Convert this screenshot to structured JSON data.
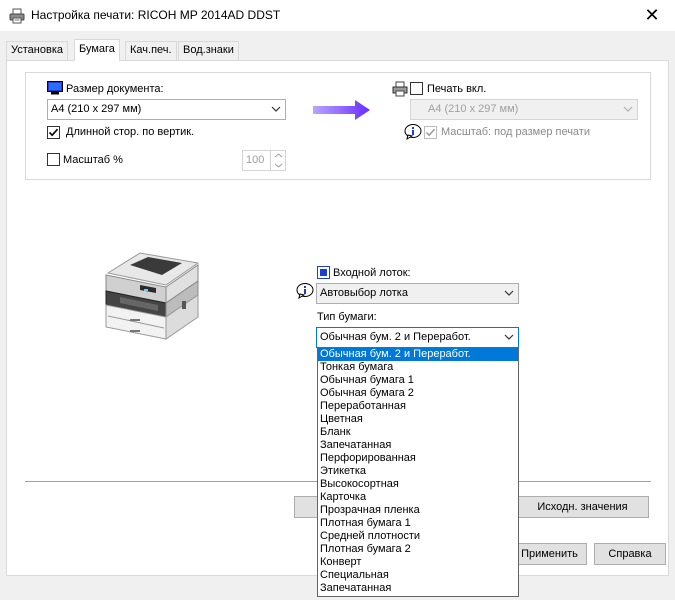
{
  "window": {
    "title": "Настройка печати: RICOH MP 2014AD DDST",
    "close_glyph": "✕"
  },
  "tabs": [
    {
      "label": "Установка"
    },
    {
      "label": "Бумага"
    },
    {
      "label": "Кач.печ."
    },
    {
      "label": "Вод.знаки"
    }
  ],
  "document": {
    "size_label": "Размер документа:",
    "size_value": "A4 (210 x 297 мм)",
    "long_edge_label": "Длинной стор. по вертик.",
    "long_edge_checked": true,
    "scale_label": "Масштаб %",
    "scale_checked": false,
    "scale_value": "100"
  },
  "print_on": {
    "label": "Печать вкл.",
    "checked": false,
    "size_value": "A4 (210 x 297 мм)",
    "fit_label": "Масштаб: под размер печати",
    "fit_checked": true
  },
  "tray": {
    "label": "Входной лоток:",
    "value": "Автовыбор лотка"
  },
  "paper_type": {
    "label": "Тип бумаги:",
    "value": "Обычная бум. 2 и Переработ.",
    "options": [
      "Обычная бум. 2 и Переработ.",
      "Тонкая бумага",
      "Обычная бумага 1",
      "Обычная бумага 2",
      "Переработанная",
      "Цветная",
      "Бланк",
      "Запечатанная",
      "Перфорированная",
      "Этикетка",
      "Высокосортная",
      "Карточка",
      "Прозрачная пленка",
      "Плотная бумага 1",
      "Средней плотности",
      "Плотная бумага 2",
      "Конверт",
      "Специальная",
      "Запечатанная"
    ],
    "selected_index": 0
  },
  "buttons": {
    "defaults": "Исходн. значения",
    "apply": "Применить",
    "help": "Справка"
  },
  "colors": {
    "accent": "#0078d7",
    "arrow": "#7a3cff"
  }
}
